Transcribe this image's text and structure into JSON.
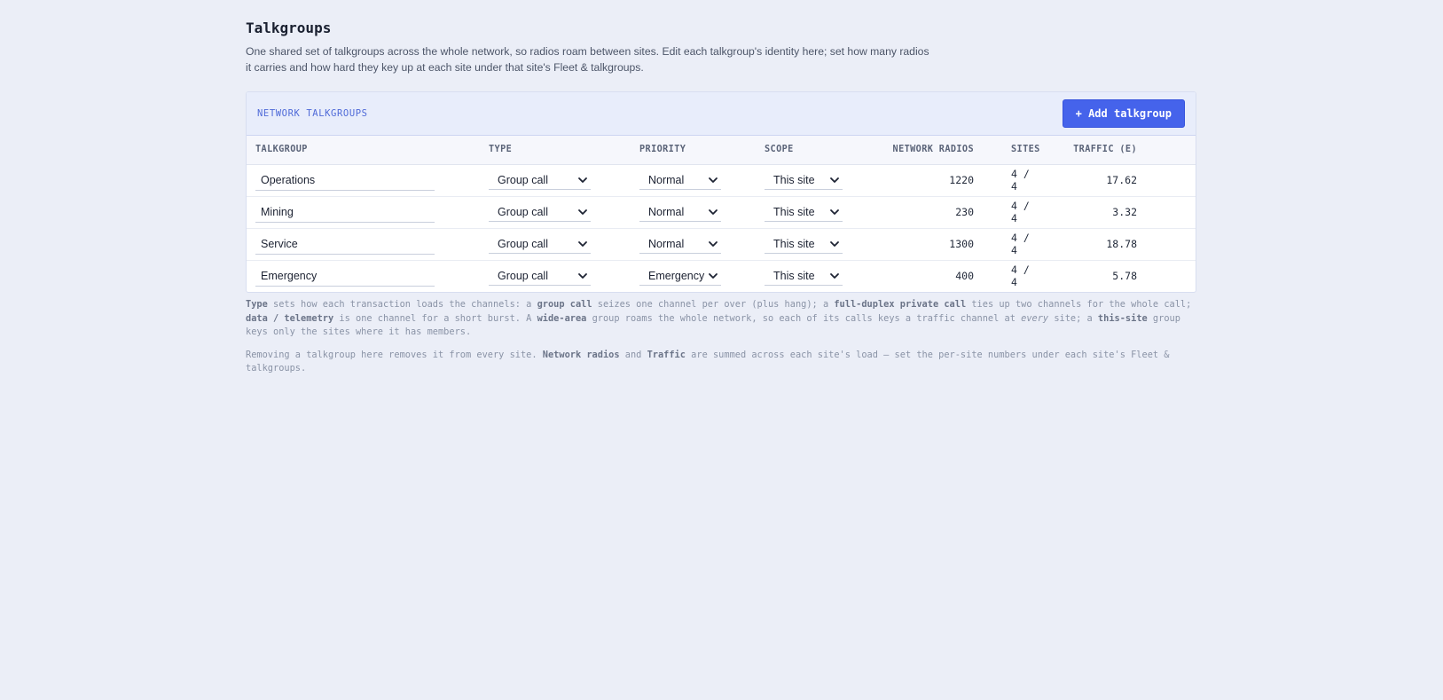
{
  "page": {
    "title": "Talkgroups",
    "description": "One shared set of talkgroups across the whole network, so radios roam between sites. Edit each talkgroup's identity here; set how many radios it carries and how hard they key up at each site under that site's Fleet & talkgroups."
  },
  "panel": {
    "label": "NETWORK TALKGROUPS",
    "add_button": "+ Add talkgroup"
  },
  "table": {
    "columns": {
      "talkgroup": "TALKGROUP",
      "type": "TYPE",
      "priority": "PRIORITY",
      "scope": "SCOPE",
      "radios": "NETWORK RADIOS",
      "sites": "SITES",
      "traffic": "TRAFFIC (E)"
    },
    "rows": [
      {
        "name": "Operations",
        "type": "Group call",
        "priority": "Normal",
        "scope": "This site",
        "radios": "1220",
        "sites": "4 / 4",
        "traffic": "17.62"
      },
      {
        "name": "Mining",
        "type": "Group call",
        "priority": "Normal",
        "scope": "This site",
        "radios": "230",
        "sites": "4 / 4",
        "traffic": "3.32"
      },
      {
        "name": "Service",
        "type": "Group call",
        "priority": "Normal",
        "scope": "This site",
        "radios": "1300",
        "sites": "4 / 4",
        "traffic": "18.78"
      },
      {
        "name": "Emergency",
        "type": "Group call",
        "priority": "Emergency",
        "scope": "This site",
        "radios": "400",
        "sites": "4 / 4",
        "traffic": "5.78"
      }
    ]
  },
  "notes": {
    "n1_type": "Type",
    "n1_a": " sets how each transaction loads the channels: a ",
    "n1_group_call": "group call",
    "n1_b": " seizes one channel per over (plus hang); a ",
    "n1_fdpc": "full-duplex private call",
    "n1_c": " ties up two channels for the whole call; ",
    "n1_data": "data / telemetry",
    "n1_d": " is one channel for a short burst. A ",
    "n1_wide": "wide-area",
    "n1_e": " group roams the whole network, so each of its calls keys a traffic channel at ",
    "n1_every": "every",
    "n1_f": " site; a ",
    "n1_this": "this-site",
    "n1_g": " group keys only the sites where it has members.",
    "n2_a": "Removing a talkgroup here removes it from every site. ",
    "n2_radios": "Network radios",
    "n2_b": " and ",
    "n2_traffic": "Traffic",
    "n2_c": " are summed across each site's load — set the per-site numbers under each site's Fleet & talkgroups."
  }
}
